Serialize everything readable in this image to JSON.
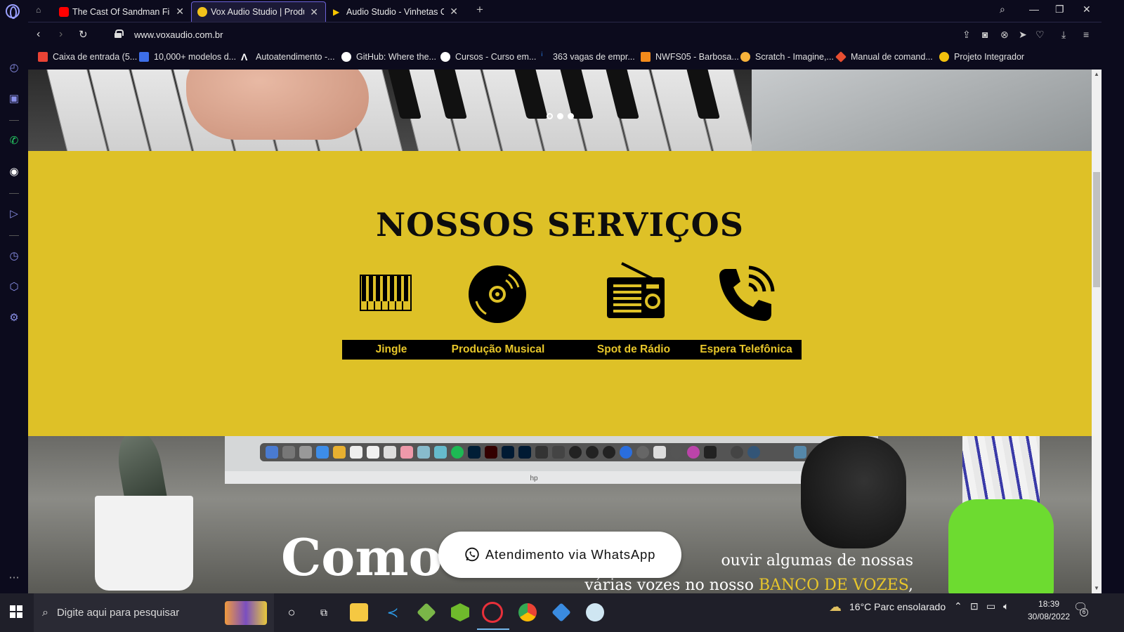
{
  "browser": {
    "tabs": [
      {
        "title": "The Cast Of Sandman Finds",
        "favicon_color": "#ff0000",
        "active": false
      },
      {
        "title": "Vox Audio Studio | Produto",
        "favicon_color": "#f2c21b",
        "active": true
      },
      {
        "title": "Audio Studio - Vinhetas Ca",
        "favicon_color": "#f7c600",
        "active": false
      }
    ],
    "new_tab_label": "+",
    "url": "www.voxaudio.com.br",
    "bookmarks": [
      {
        "label": "Caixa de entrada (5...",
        "color": "#ea4335"
      },
      {
        "label": "10,000+ modelos d...",
        "color": "#3d6ee8"
      },
      {
        "label": "Autoatendimento -...",
        "color": "#ffffff"
      },
      {
        "label": "GitHub: Where the...",
        "color": "#ffffff"
      },
      {
        "label": "Cursos - Curso em...",
        "color": "#ffffff"
      },
      {
        "label": "363 vagas de empr...",
        "color": "#2a7ae2"
      },
      {
        "label": "NWFS05 - Barbosa...",
        "color": "#f28a1b"
      },
      {
        "label": "Scratch - Imagine,...",
        "color": "#f7b23b"
      },
      {
        "label": "Manual de comand...",
        "color": "#e84e31"
      },
      {
        "label": "Projeto Integrador",
        "color": "#f4c20d"
      }
    ]
  },
  "page": {
    "services": {
      "title": "NOSSOS SERVIÇOS",
      "items": [
        {
          "label": "Jingle",
          "icon": "piano-icon"
        },
        {
          "label": "Produção Musical",
          "icon": "disc-icon"
        },
        {
          "label": "Spot de Rádio",
          "icon": "radio-icon"
        },
        {
          "label": "Espera Telefônica",
          "icon": "phone-icon"
        }
      ]
    },
    "studio": {
      "heading": "Como",
      "text_line1": "ouvir algumas de nossas",
      "text_line2_prefix": "várias vozes no nosso",
      "text_highlight": "BANCO DE VOZES",
      "text_line2_suffix": ", escolher"
    },
    "whatsapp_button": "Atendimento via WhatsApp"
  },
  "taskbar": {
    "search_placeholder": "Digite aqui para pesquisar",
    "weather": "16°C  Parc ensolarado",
    "time": "18:39",
    "date": "30/08/2022",
    "notifications": "6"
  }
}
